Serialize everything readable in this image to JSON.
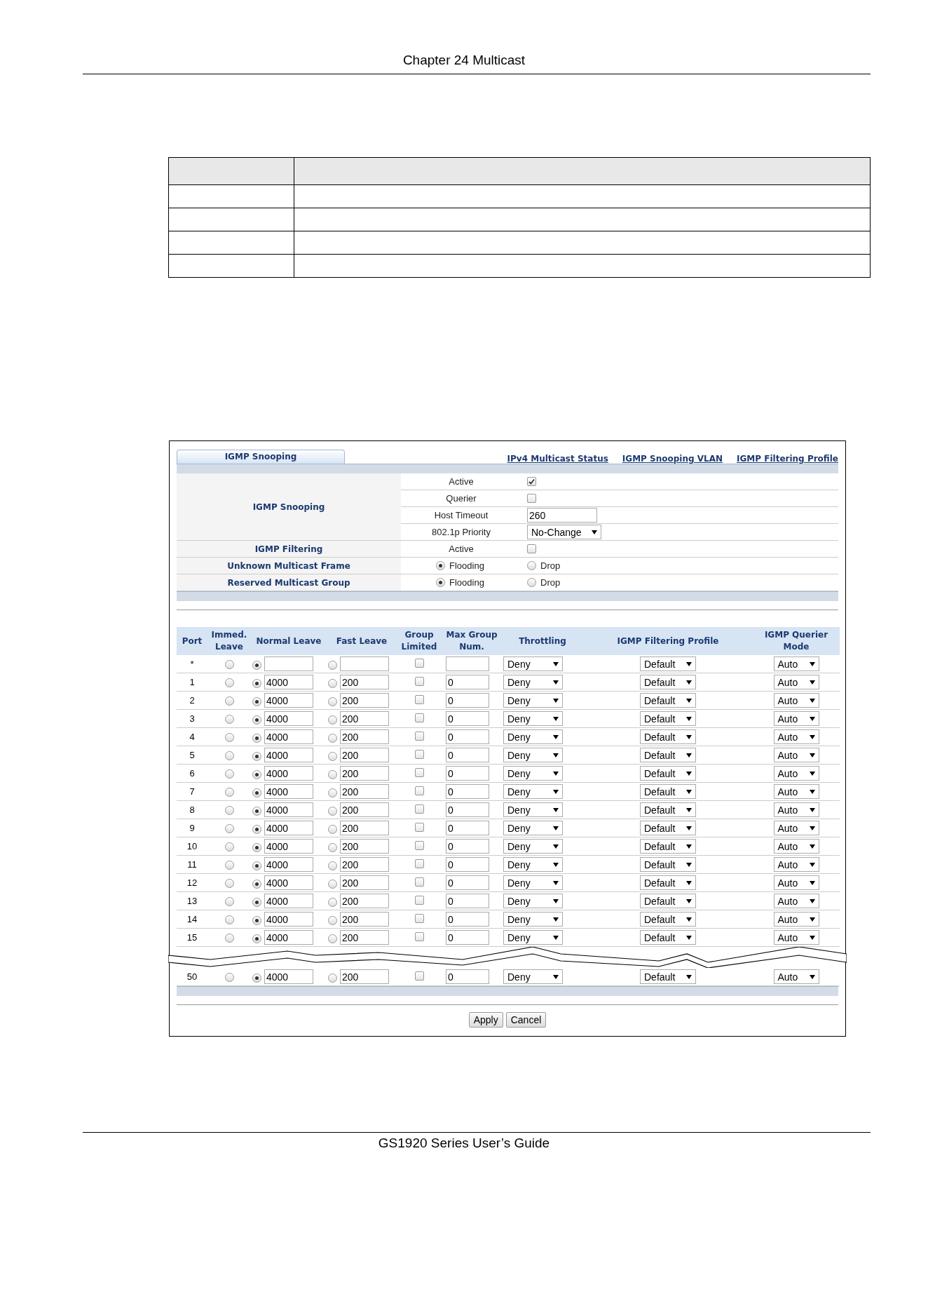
{
  "page_header": "Chapter 24 Multicast",
  "tabs": [
    {
      "label": "IGMP Snooping",
      "selected": true
    }
  ],
  "links": [
    "IPv4 Multicast Status",
    "IGMP Snooping VLAN",
    "IGMP Filtering Profile"
  ],
  "settings": [
    {
      "group": "IGMP Snooping",
      "items": [
        {
          "kind": "checkbox",
          "label": "Active",
          "checked": true
        },
        {
          "kind": "checkbox",
          "label": "Querier",
          "checked": false
        },
        {
          "kind": "text",
          "label": "Host Timeout",
          "value": "260"
        },
        {
          "kind": "select",
          "label": "802.1p Priority",
          "value": "No-Change"
        }
      ]
    },
    {
      "group": "IGMP Filtering",
      "items": [
        {
          "kind": "checkbox",
          "label": "Active",
          "checked": false
        }
      ]
    },
    {
      "group": "Unknown Multicast Frame",
      "items": [
        {
          "kind": "radio",
          "options": [
            {
              "label": "Flooding",
              "selected": true
            },
            {
              "label": "Drop",
              "selected": false
            }
          ]
        }
      ]
    },
    {
      "group": "Reserved Multicast Group",
      "items": [
        {
          "kind": "radio",
          "options": [
            {
              "label": "Flooding",
              "selected": true
            },
            {
              "label": "Drop",
              "selected": false
            }
          ]
        }
      ]
    }
  ],
  "port_table": {
    "columns": [
      "Port",
      "Immed. Leave",
      "Normal Leave",
      "Fast Leave",
      "Group Limited",
      "Max Group Num.",
      "Throttling",
      "IGMP Filtering Profile",
      "IGMP Querier Mode"
    ],
    "rows": [
      {
        "port": "*",
        "immed_leave_selected": false,
        "normal_leave_selected": true,
        "fast_leave_selected": false,
        "group_limited": false,
        "throttling": "Deny",
        "profile": "Default",
        "querier_mode": "Auto"
      },
      {
        "port": "1",
        "immed_leave_selected": false,
        "normal_leave_selected": true,
        "normal_leave": "4000",
        "fast_leave_selected": false,
        "fast_leave": "200",
        "group_limited": false,
        "max_group": "0",
        "throttling": "Deny",
        "profile": "Default",
        "querier_mode": "Auto"
      },
      {
        "port": "2",
        "immed_leave_selected": false,
        "normal_leave_selected": true,
        "normal_leave": "4000",
        "fast_leave_selected": false,
        "fast_leave": "200",
        "group_limited": false,
        "max_group": "0",
        "throttling": "Deny",
        "profile": "Default",
        "querier_mode": "Auto"
      },
      {
        "port": "3",
        "immed_leave_selected": false,
        "normal_leave_selected": true,
        "normal_leave": "4000",
        "fast_leave_selected": false,
        "fast_leave": "200",
        "group_limited": false,
        "max_group": "0",
        "throttling": "Deny",
        "profile": "Default",
        "querier_mode": "Auto"
      },
      {
        "port": "4",
        "immed_leave_selected": false,
        "normal_leave_selected": true,
        "normal_leave": "4000",
        "fast_leave_selected": false,
        "fast_leave": "200",
        "group_limited": false,
        "max_group": "0",
        "throttling": "Deny",
        "profile": "Default",
        "querier_mode": "Auto"
      },
      {
        "port": "5",
        "immed_leave_selected": false,
        "normal_leave_selected": true,
        "normal_leave": "4000",
        "fast_leave_selected": false,
        "fast_leave": "200",
        "group_limited": false,
        "max_group": "0",
        "throttling": "Deny",
        "profile": "Default",
        "querier_mode": "Auto"
      },
      {
        "port": "6",
        "immed_leave_selected": false,
        "normal_leave_selected": true,
        "normal_leave": "4000",
        "fast_leave_selected": false,
        "fast_leave": "200",
        "group_limited": false,
        "max_group": "0",
        "throttling": "Deny",
        "profile": "Default",
        "querier_mode": "Auto"
      },
      {
        "port": "7",
        "immed_leave_selected": false,
        "normal_leave_selected": true,
        "normal_leave": "4000",
        "fast_leave_selected": false,
        "fast_leave": "200",
        "group_limited": false,
        "max_group": "0",
        "throttling": "Deny",
        "profile": "Default",
        "querier_mode": "Auto"
      },
      {
        "port": "8",
        "immed_leave_selected": false,
        "normal_leave_selected": true,
        "normal_leave": "4000",
        "fast_leave_selected": false,
        "fast_leave": "200",
        "group_limited": false,
        "max_group": "0",
        "throttling": "Deny",
        "profile": "Default",
        "querier_mode": "Auto"
      },
      {
        "port": "9",
        "immed_leave_selected": false,
        "normal_leave_selected": true,
        "normal_leave": "4000",
        "fast_leave_selected": false,
        "fast_leave": "200",
        "group_limited": false,
        "max_group": "0",
        "throttling": "Deny",
        "profile": "Default",
        "querier_mode": "Auto"
      },
      {
        "port": "10",
        "immed_leave_selected": false,
        "normal_leave_selected": true,
        "normal_leave": "4000",
        "fast_leave_selected": false,
        "fast_leave": "200",
        "group_limited": false,
        "max_group": "0",
        "throttling": "Deny",
        "profile": "Default",
        "querier_mode": "Auto"
      },
      {
        "port": "11",
        "immed_leave_selected": false,
        "normal_leave_selected": true,
        "normal_leave": "4000",
        "fast_leave_selected": false,
        "fast_leave": "200",
        "group_limited": false,
        "max_group": "0",
        "throttling": "Deny",
        "profile": "Default",
        "querier_mode": "Auto"
      },
      {
        "port": "12",
        "immed_leave_selected": false,
        "normal_leave_selected": true,
        "normal_leave": "4000",
        "fast_leave_selected": false,
        "fast_leave": "200",
        "group_limited": false,
        "max_group": "0",
        "throttling": "Deny",
        "profile": "Default",
        "querier_mode": "Auto"
      },
      {
        "port": "13",
        "immed_leave_selected": false,
        "normal_leave_selected": true,
        "normal_leave": "4000",
        "fast_leave_selected": false,
        "fast_leave": "200",
        "group_limited": false,
        "max_group": "0",
        "throttling": "Deny",
        "profile": "Default",
        "querier_mode": "Auto"
      },
      {
        "port": "14",
        "immed_leave_selected": false,
        "normal_leave_selected": true,
        "normal_leave": "4000",
        "fast_leave_selected": false,
        "fast_leave": "200",
        "group_limited": false,
        "max_group": "0",
        "throttling": "Deny",
        "profile": "Default",
        "querier_mode": "Auto"
      },
      {
        "port": "15",
        "immed_leave_selected": false,
        "normal_leave_selected": true,
        "normal_leave": "4000",
        "fast_leave_selected": false,
        "fast_leave": "200",
        "group_limited": false,
        "max_group": "0",
        "throttling": "Deny",
        "profile": "Default",
        "querier_mode": "Auto"
      },
      {
        "port": "50",
        "break_before": true,
        "immed_leave_selected": false,
        "normal_leave_selected": true,
        "normal_leave": "4000",
        "fast_leave_selected": false,
        "fast_leave": "200",
        "group_limited": false,
        "max_group": "0",
        "throttling": "Deny",
        "profile": "Default",
        "querier_mode": "Auto"
      }
    ]
  },
  "buttons": [
    "Apply",
    "Cancel"
  ],
  "page_footer": "GS1920 Series User’s Guide"
}
